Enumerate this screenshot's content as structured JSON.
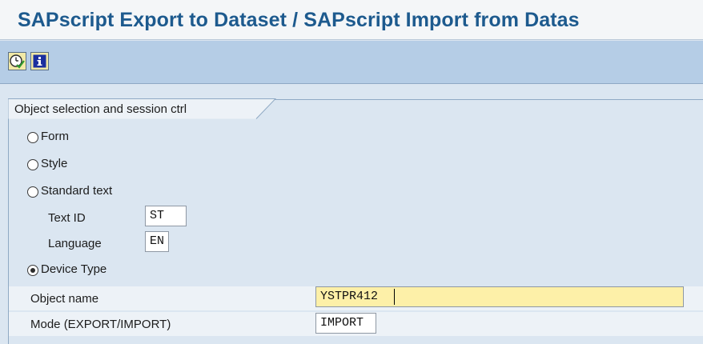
{
  "title": "SAPscript Export to Dataset / SAPscript Import from Datas",
  "toolbar": {
    "execute_icon": "execute-clock-icon",
    "info_icon": "information-icon"
  },
  "group": {
    "title": "Object selection and session ctrl"
  },
  "options": {
    "form": "Form",
    "style": "Style",
    "standard_text": "Standard text",
    "device_type": "Device Type",
    "selected": "Device Type"
  },
  "fields": {
    "text_id_label": "Text ID",
    "text_id_value": "ST",
    "language_label": "Language",
    "language_value": "EN",
    "object_name_label": "Object name",
    "object_name_value": "YSTPR412",
    "mode_label": "Mode (EXPORT/IMPORT)",
    "mode_value": "IMPORT"
  },
  "colors": {
    "title": "#1d5a8e",
    "toolbar": "#b5cde6",
    "background": "#dbe6f1",
    "focus_field": "#fdf0a8"
  }
}
